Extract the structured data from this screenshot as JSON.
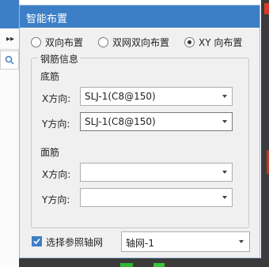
{
  "dialog": {
    "title": "智能布置",
    "layout_options": [
      {
        "label": "双向布置",
        "checked": false
      },
      {
        "label": "双网双向布置",
        "checked": false
      },
      {
        "label": "XY 向布置",
        "checked": true
      }
    ],
    "group_title": "钢筋信息",
    "bottom_section": {
      "title": "底筋",
      "x_label": "X方向:",
      "x_value": "SLJ-1(C8@150)",
      "y_label": "Y方向:",
      "y_value": "SLJ-1(C8@150)"
    },
    "top_section": {
      "title": "面筋",
      "x_label": "X方向:",
      "x_value": "",
      "y_label": "Y方向:",
      "y_value": ""
    },
    "axis_checkbox": {
      "label": "选择参照轴网",
      "checked": true
    },
    "axis_value": "轴网-1"
  },
  "background": {
    "left_arrows": "▸▸",
    "accent": "#3d7fc7"
  }
}
